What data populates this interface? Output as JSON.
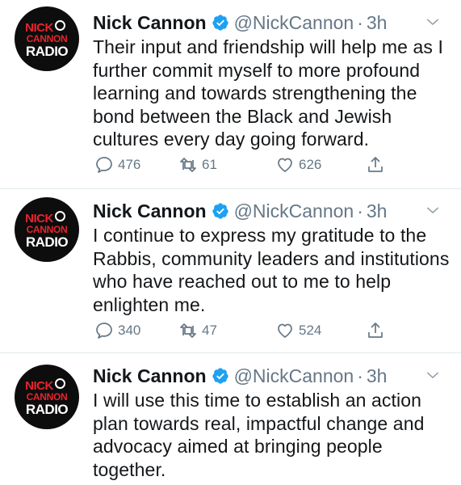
{
  "tweets": [
    {
      "avatar_text": [
        "NICK",
        "CANNON",
        "RADIO"
      ],
      "name": "Nick Cannon",
      "handle": "@NickCannon",
      "separator": "·",
      "time": "3h",
      "text": "Their input and friendship will help me as I further commit myself to more profound learning and towards strengthening the bond between the Black and Jewish cultures every day going forward.",
      "replies": "476",
      "retweets": "61",
      "likes": "626"
    },
    {
      "avatar_text": [
        "NICK",
        "CANNON",
        "RADIO"
      ],
      "name": "Nick Cannon",
      "handle": "@NickCannon",
      "separator": "·",
      "time": "3h",
      "text": "I continue to express my gratitude to the Rabbis, community leaders and institutions who have reached out to me to help enlighten me.",
      "replies": "340",
      "retweets": "47",
      "likes": "524"
    },
    {
      "avatar_text": [
        "NICK",
        "CANNON",
        "RADIO"
      ],
      "name": "Nick Cannon",
      "handle": "@NickCannon",
      "separator": "·",
      "time": "3h",
      "text": "I will use this time to establish an action plan towards real, impactful change and advocacy aimed at bringing people together."
    }
  ],
  "icons": {
    "verified": "verified-badge-icon",
    "menu": "chevron-down-icon",
    "reply": "reply-icon",
    "retweet": "retweet-icon",
    "like": "heart-icon",
    "share": "share-icon"
  },
  "colors": {
    "verified_blue": "#1da1f2",
    "secondary_text": "#657786",
    "primary_text": "#14171a",
    "avatar_red": "#e8242c",
    "divider": "#e1e8ed"
  }
}
